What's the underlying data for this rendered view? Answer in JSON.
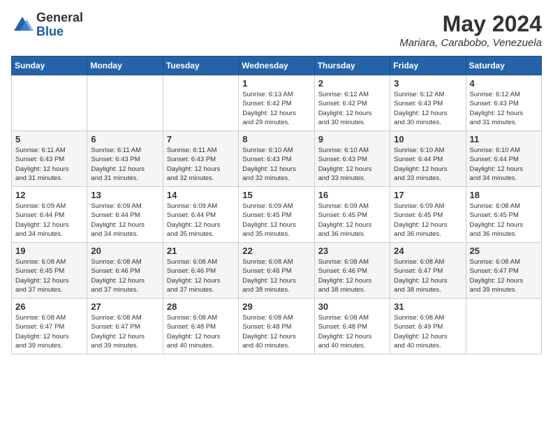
{
  "header": {
    "logo_general": "General",
    "logo_blue": "Blue",
    "month_title": "May 2024",
    "location": "Mariara, Carabobo, Venezuela"
  },
  "days_of_week": [
    "Sunday",
    "Monday",
    "Tuesday",
    "Wednesday",
    "Thursday",
    "Friday",
    "Saturday"
  ],
  "weeks": [
    [
      {
        "day": "",
        "info": ""
      },
      {
        "day": "",
        "info": ""
      },
      {
        "day": "",
        "info": ""
      },
      {
        "day": "1",
        "info": "Sunrise: 6:13 AM\nSunset: 6:42 PM\nDaylight: 12 hours\nand 29 minutes."
      },
      {
        "day": "2",
        "info": "Sunrise: 6:12 AM\nSunset: 6:42 PM\nDaylight: 12 hours\nand 30 minutes."
      },
      {
        "day": "3",
        "info": "Sunrise: 6:12 AM\nSunset: 6:43 PM\nDaylight: 12 hours\nand 30 minutes."
      },
      {
        "day": "4",
        "info": "Sunrise: 6:12 AM\nSunset: 6:43 PM\nDaylight: 12 hours\nand 31 minutes."
      }
    ],
    [
      {
        "day": "5",
        "info": "Sunrise: 6:11 AM\nSunset: 6:43 PM\nDaylight: 12 hours\nand 31 minutes."
      },
      {
        "day": "6",
        "info": "Sunrise: 6:11 AM\nSunset: 6:43 PM\nDaylight: 12 hours\nand 31 minutes."
      },
      {
        "day": "7",
        "info": "Sunrise: 6:11 AM\nSunset: 6:43 PM\nDaylight: 12 hours\nand 32 minutes."
      },
      {
        "day": "8",
        "info": "Sunrise: 6:10 AM\nSunset: 6:43 PM\nDaylight: 12 hours\nand 32 minutes."
      },
      {
        "day": "9",
        "info": "Sunrise: 6:10 AM\nSunset: 6:43 PM\nDaylight: 12 hours\nand 33 minutes."
      },
      {
        "day": "10",
        "info": "Sunrise: 6:10 AM\nSunset: 6:44 PM\nDaylight: 12 hours\nand 33 minutes."
      },
      {
        "day": "11",
        "info": "Sunrise: 6:10 AM\nSunset: 6:44 PM\nDaylight: 12 hours\nand 34 minutes."
      }
    ],
    [
      {
        "day": "12",
        "info": "Sunrise: 6:09 AM\nSunset: 6:44 PM\nDaylight: 12 hours\nand 34 minutes."
      },
      {
        "day": "13",
        "info": "Sunrise: 6:09 AM\nSunset: 6:44 PM\nDaylight: 12 hours\nand 34 minutes."
      },
      {
        "day": "14",
        "info": "Sunrise: 6:09 AM\nSunset: 6:44 PM\nDaylight: 12 hours\nand 35 minutes."
      },
      {
        "day": "15",
        "info": "Sunrise: 6:09 AM\nSunset: 6:45 PM\nDaylight: 12 hours\nand 35 minutes."
      },
      {
        "day": "16",
        "info": "Sunrise: 6:09 AM\nSunset: 6:45 PM\nDaylight: 12 hours\nand 36 minutes."
      },
      {
        "day": "17",
        "info": "Sunrise: 6:09 AM\nSunset: 6:45 PM\nDaylight: 12 hours\nand 36 minutes."
      },
      {
        "day": "18",
        "info": "Sunrise: 6:08 AM\nSunset: 6:45 PM\nDaylight: 12 hours\nand 36 minutes."
      }
    ],
    [
      {
        "day": "19",
        "info": "Sunrise: 6:08 AM\nSunset: 6:45 PM\nDaylight: 12 hours\nand 37 minutes."
      },
      {
        "day": "20",
        "info": "Sunrise: 6:08 AM\nSunset: 6:46 PM\nDaylight: 12 hours\nand 37 minutes."
      },
      {
        "day": "21",
        "info": "Sunrise: 6:08 AM\nSunset: 6:46 PM\nDaylight: 12 hours\nand 37 minutes."
      },
      {
        "day": "22",
        "info": "Sunrise: 6:08 AM\nSunset: 6:46 PM\nDaylight: 12 hours\nand 38 minutes."
      },
      {
        "day": "23",
        "info": "Sunrise: 6:08 AM\nSunset: 6:46 PM\nDaylight: 12 hours\nand 38 minutes."
      },
      {
        "day": "24",
        "info": "Sunrise: 6:08 AM\nSunset: 6:47 PM\nDaylight: 12 hours\nand 38 minutes."
      },
      {
        "day": "25",
        "info": "Sunrise: 6:08 AM\nSunset: 6:47 PM\nDaylight: 12 hours\nand 39 minutes."
      }
    ],
    [
      {
        "day": "26",
        "info": "Sunrise: 6:08 AM\nSunset: 6:47 PM\nDaylight: 12 hours\nand 39 minutes."
      },
      {
        "day": "27",
        "info": "Sunrise: 6:08 AM\nSunset: 6:47 PM\nDaylight: 12 hours\nand 39 minutes."
      },
      {
        "day": "28",
        "info": "Sunrise: 6:08 AM\nSunset: 6:48 PM\nDaylight: 12 hours\nand 40 minutes."
      },
      {
        "day": "29",
        "info": "Sunrise: 6:08 AM\nSunset: 6:48 PM\nDaylight: 12 hours\nand 40 minutes."
      },
      {
        "day": "30",
        "info": "Sunrise: 6:08 AM\nSunset: 6:48 PM\nDaylight: 12 hours\nand 40 minutes."
      },
      {
        "day": "31",
        "info": "Sunrise: 6:08 AM\nSunset: 6:49 PM\nDaylight: 12 hours\nand 40 minutes."
      },
      {
        "day": "",
        "info": ""
      }
    ]
  ]
}
